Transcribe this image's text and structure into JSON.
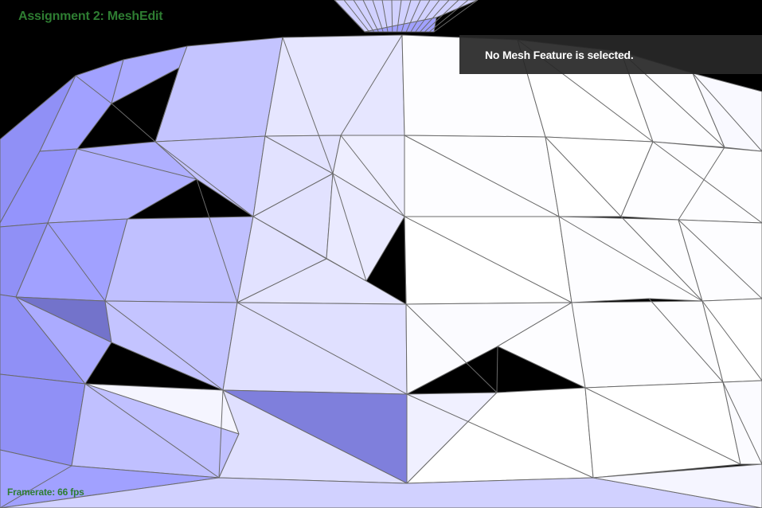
{
  "app": {
    "title": "Assignment 2: MeshEdit"
  },
  "status": {
    "framerate": "Framerate: 66 fps"
  },
  "selection_panel": {
    "message": "No Mesh Feature is selected."
  },
  "colors": {
    "background": "#000000",
    "hud_text": "#2e7d32",
    "edge_color": "#6a6a6a",
    "panel_bg": "#282828",
    "panel_text": "#ffffff",
    "mesh_lit": "#ffffff",
    "mesh_shadow": "#5c5ca8"
  }
}
